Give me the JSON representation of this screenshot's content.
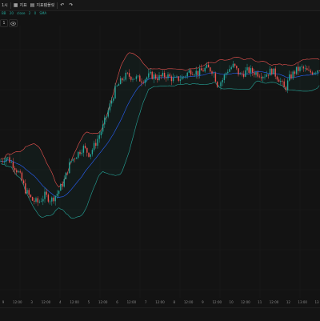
{
  "toolbar": {
    "interval_label": "1시",
    "indicator_label": "지표",
    "template_label": "지표템플릿"
  },
  "legend": {
    "items": [
      "BB",
      "20",
      "close",
      "2",
      "0",
      "SMA"
    ]
  },
  "indicator_counter": "1",
  "chart_data": {
    "type": "candlestick",
    "indicator": "Bollinger Bands",
    "colors": {
      "up": "#26a69a",
      "down": "#ef5350",
      "basis": "#2962ff",
      "band": "#26a69a",
      "grid": "#1c1c1c"
    },
    "y_range": [
      0,
      100
    ],
    "x_tick_labels": [
      "9",
      "12:00",
      "3",
      "12:00",
      "4",
      "12:00",
      "5",
      "12:00",
      "6",
      "12:00",
      "7",
      "12:00",
      "8",
      "12:00",
      "9",
      "12:00",
      "10",
      "12:00",
      "11",
      "12:00",
      "12",
      "13:00",
      "13"
    ],
    "price_path": [
      [
        0,
        50
      ],
      [
        8,
        52
      ],
      [
        16,
        49
      ],
      [
        24,
        45
      ],
      [
        32,
        38
      ],
      [
        40,
        34
      ],
      [
        48,
        33
      ],
      [
        56,
        36
      ],
      [
        64,
        34
      ],
      [
        72,
        37
      ],
      [
        80,
        42
      ],
      [
        88,
        50
      ],
      [
        96,
        53
      ],
      [
        104,
        56
      ],
      [
        112,
        53
      ],
      [
        120,
        58
      ],
      [
        128,
        64
      ],
      [
        136,
        72
      ],
      [
        144,
        80
      ],
      [
        152,
        84
      ],
      [
        158,
        86
      ],
      [
        168,
        85
      ],
      [
        178,
        84
      ],
      [
        188,
        86
      ],
      [
        198,
        85
      ],
      [
        208,
        86
      ],
      [
        218,
        84
      ],
      [
        228,
        85
      ],
      [
        238,
        88
      ],
      [
        248,
        87
      ],
      [
        258,
        89
      ],
      [
        266,
        88
      ],
      [
        272,
        82
      ],
      [
        278,
        84
      ],
      [
        284,
        88
      ],
      [
        292,
        90
      ],
      [
        300,
        86
      ],
      [
        310,
        88
      ],
      [
        320,
        87
      ],
      [
        330,
        86
      ],
      [
        340,
        88
      ],
      [
        350,
        84
      ],
      [
        356,
        80
      ],
      [
        362,
        85
      ],
      [
        370,
        88
      ],
      [
        378,
        89
      ],
      [
        386,
        87
      ],
      [
        394,
        88
      ],
      [
        400,
        89
      ]
    ]
  }
}
